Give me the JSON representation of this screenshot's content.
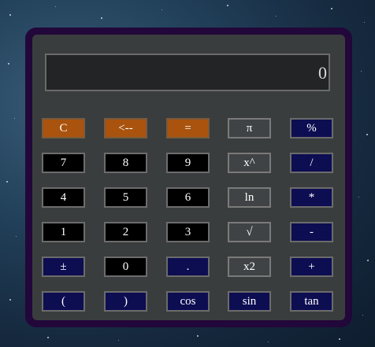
{
  "colors": {
    "frame": "#22073a",
    "panel": "#3a3d3e",
    "display_bg": "#222425",
    "orange": "#a9530e",
    "black": "#000000",
    "gray": "#404345",
    "navy": "#0d0d52"
  },
  "display": {
    "value": "0"
  },
  "buttons": {
    "clear": "C",
    "backspace": "<--",
    "equals": "=",
    "pi": "π",
    "percent": "%",
    "seven": "7",
    "eight": "8",
    "nine": "9",
    "power": "x^",
    "divide": "/",
    "four": "4",
    "five": "5",
    "six": "6",
    "ln": "ln",
    "multiply": "*",
    "one": "1",
    "two": "2",
    "three": "3",
    "sqrt": "√",
    "minus": "-",
    "plusminus": "±",
    "zero": "0",
    "dot": ".",
    "square": "x2",
    "plus": "+",
    "open_paren": "(",
    "close_paren": ")",
    "cos": "cos",
    "sin": "sin",
    "tan": "tan"
  }
}
